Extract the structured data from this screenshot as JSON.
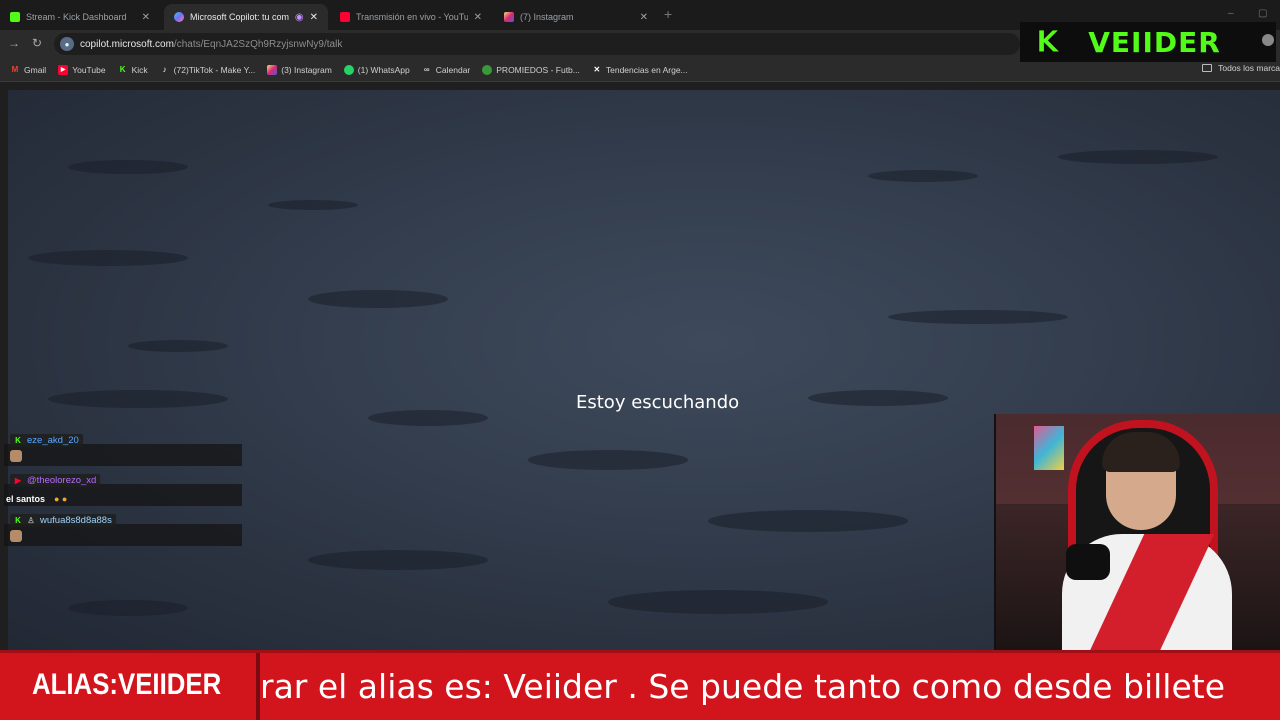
{
  "tabs": [
    {
      "title": "Stream - Kick Dashboard",
      "icon": "kick-icon",
      "color": "#53fc18",
      "active": false
    },
    {
      "title": "Microsoft Copilot: tu compa",
      "icon": "copilot-icon",
      "color": "#7a6cf0",
      "active": true
    },
    {
      "title": "Transmisión en vivo - YouTube",
      "icon": "youtube-icon",
      "color": "#ff0033",
      "active": false
    },
    {
      "title": "(7) Instagram",
      "icon": "instagram-icon",
      "color": "#e1306c",
      "active": false
    }
  ],
  "address": {
    "host": "copilot.microsoft.com",
    "path": "/chats/EqnJA2SzQh9RzyjsnwNy9/talk"
  },
  "bookmarks": [
    {
      "label": "Gmail",
      "icon": "gmail-icon",
      "color": "#ea4335"
    },
    {
      "label": "YouTube",
      "icon": "youtube-icon",
      "color": "#ff0033"
    },
    {
      "label": "Kick",
      "icon": "kick-icon",
      "color": "#53fc18"
    },
    {
      "label": "(72)TikTok - Make Y...",
      "icon": "tiktok-icon",
      "color": "#ffffff"
    },
    {
      "label": "(3) Instagram",
      "icon": "instagram-icon",
      "color": "#e1306c"
    },
    {
      "label": "(1) WhatsApp",
      "icon": "whatsapp-icon",
      "color": "#25d366"
    },
    {
      "label": "Calendar",
      "icon": "calendar-icon",
      "color": "#cccccc"
    },
    {
      "label": "PROMIEDOS - Futb...",
      "icon": "promiedos-icon",
      "color": "#3a9a3a"
    },
    {
      "label": "Tendencias en Arge...",
      "icon": "x-icon",
      "color": "#ffffff"
    }
  ],
  "bookmarks_all": "Todos los marca",
  "overlay_logo": {
    "k": "K",
    "name": "VEIIDER"
  },
  "stage": {
    "status": "Estoy escuchando"
  },
  "chat": [
    {
      "user": "eze_akd_20",
      "platform": "kick",
      "user_color": "#5aa9ff",
      "message": ""
    },
    {
      "user": "@theolorezo_xd",
      "platform": "youtube",
      "user_color": "#b86bff",
      "message": "el santos"
    },
    {
      "user": "wufua8s8d8a88s",
      "platform": "kick",
      "user_color": "#9fd4ff",
      "message": ""
    }
  ],
  "ticker": {
    "alias": "ALIAS:VEIIDER",
    "scroll": "rar el alias es: Veiider . Se puede tanto como desde billete"
  }
}
